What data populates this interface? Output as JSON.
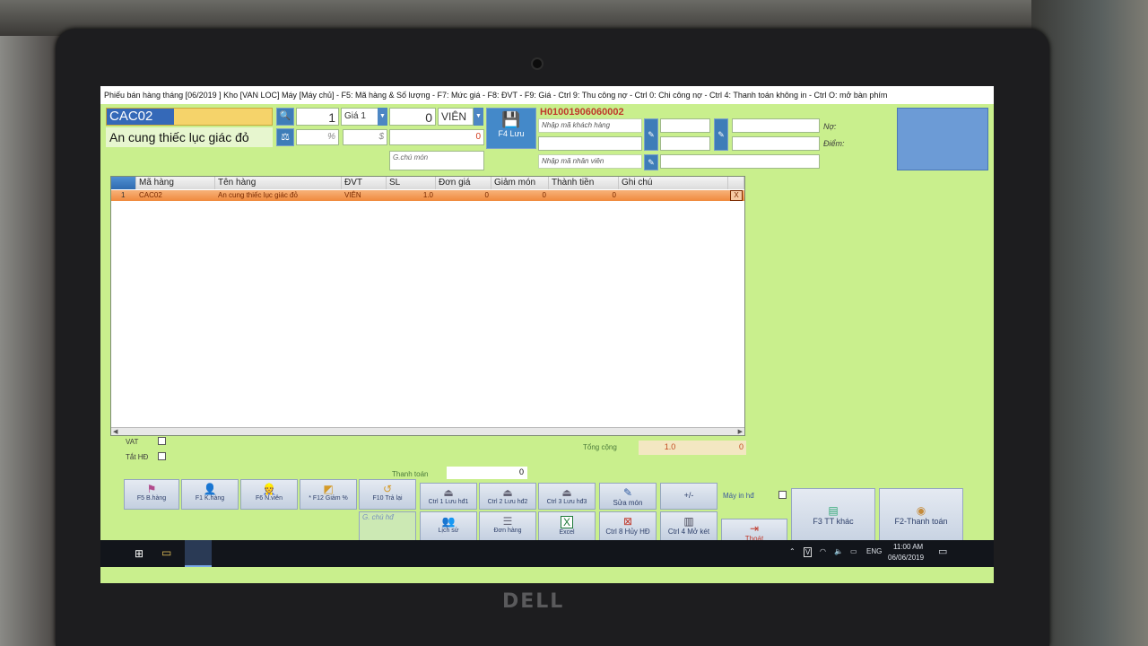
{
  "window": {
    "title": "Phiếu bán hàng tháng [06/2019 ] Kho [VAN LOC] Máy [Máy chủ] - F5: Mã hàng & Số lượng - F7: Mức giá - F8: ĐVT - F9: Giá - Ctrl 9: Thu công nợ - Ctrl 0: Chi công nợ - Ctrl 4: Thanh toán không in - Ctrl O: mở bàn phím"
  },
  "entry": {
    "code_value": "CAC02",
    "name_value": "An cung thiếc lục giác đỏ",
    "quantity": "1",
    "price_level": "Giá 1",
    "amount": "0",
    "unit": "VIÊN",
    "percent_placeholder": "%",
    "dollar_placeholder": "$",
    "total_value": "0",
    "note_placeholder": "G.chú món"
  },
  "save_button": {
    "label": "F4 Lưu"
  },
  "invoice": {
    "number": "H01001906060002",
    "customer_placeholder": "Nhập mã khách hàng",
    "staff_placeholder": "Nhập mã nhân viên",
    "debt_label": "Nợ:",
    "points_label": "Điểm:"
  },
  "grid": {
    "columns": [
      "Mã hàng",
      "Tên hàng",
      "ĐVT",
      "SL",
      "Đơn giá",
      "Giảm món",
      "Thành tiền",
      "Ghi chú"
    ],
    "rows": [
      {
        "index": "1",
        "code": "CAC02",
        "name": "An cung thiếc lục giác đỏ",
        "unit": "VIÊN",
        "qty": "1.0",
        "price": "0",
        "discount": "0",
        "total": "0",
        "note": "",
        "delete": "X"
      }
    ]
  },
  "summary": {
    "vat_label": "VAT",
    "hd_label": "Tắt HĐ",
    "total_label": "Tổng cộng",
    "total_qty": "1.0",
    "total_amount": "0",
    "payment_label": "Thanh toán",
    "payment_value": "0",
    "printer_label": "Máy in hđ",
    "gchu_label": "G. chú hđ"
  },
  "buttons": {
    "f5": "F5 B.hàng",
    "f1": "F1 K.hàng",
    "f6": "F6 N.viên",
    "f12": "* F12 Giảm %",
    "f10": "F10 Trả lại",
    "ctrl1": "Ctrl 1 Lưu hđ1",
    "ctrl2": "Ctrl 2 Lưu hđ2",
    "ctrl3": "Ctrl 3 Lưu hđ3",
    "edit": "Sửa món",
    "plusminus": "+/-",
    "history": "Lịch sử",
    "orders": "Đơn hàng",
    "excel": "Excel",
    "ctrl8": "Ctrl 8 Hủy HĐ",
    "ctrl4": "Ctrl 4 Mở két",
    "exit": "Thoát",
    "f3": "F3 TT khác",
    "f2": "F2-Thanh toán"
  },
  "taskbar": {
    "lang": "ENG",
    "time": "11:00 AM",
    "date": "06/06/2019"
  },
  "brand": "DELL",
  "colors": {
    "screen_bg": "#c9ef8d",
    "accent_blue": "#3e7db8",
    "row_orange": "#f08a3e",
    "invoice_red": "#c0392b"
  }
}
